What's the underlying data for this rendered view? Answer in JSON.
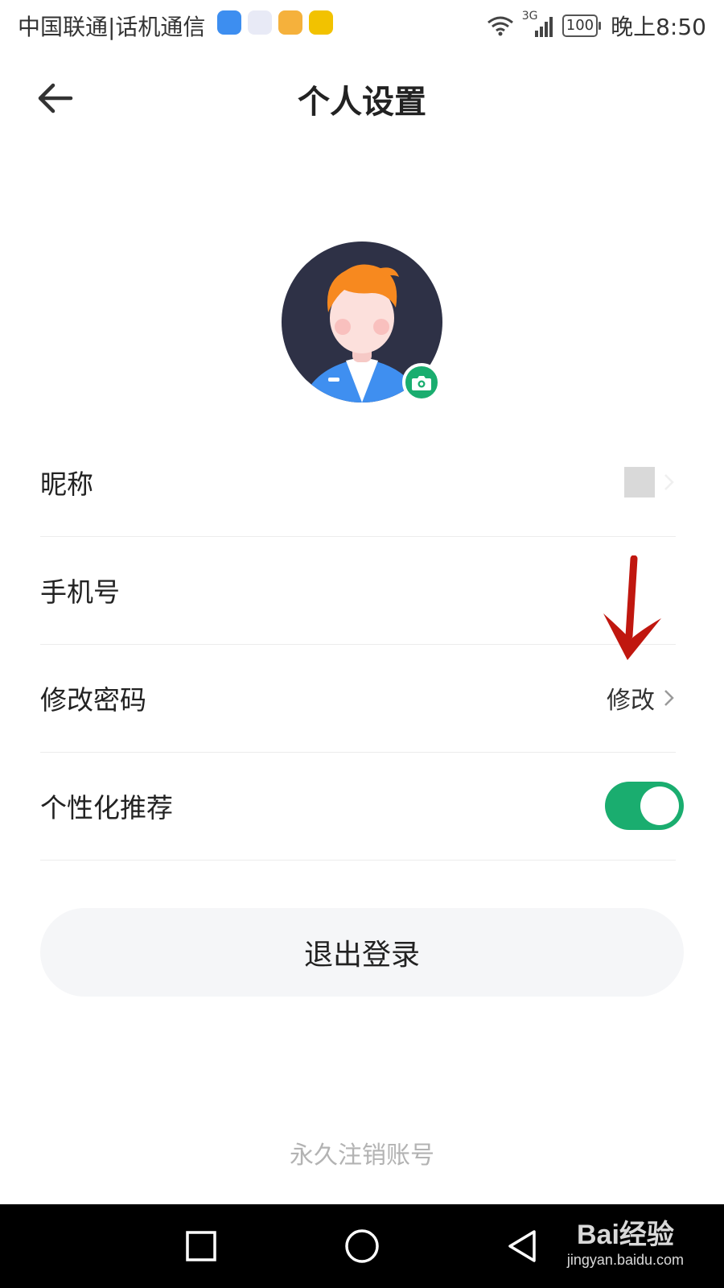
{
  "status_bar": {
    "carrier": "中国联通|话机通信",
    "network": "3G",
    "battery": "100",
    "time": "晚上8:50",
    "app_icons": [
      "bulb-app-icon",
      "robot-app-icon",
      "box-app-icon",
      "quiz-app-icon"
    ]
  },
  "header": {
    "title": "个人设置",
    "back_icon": "arrow-left-icon"
  },
  "avatar": {
    "camera_icon": "camera-icon",
    "badge_color": "#1aad6f"
  },
  "settings": {
    "nickname": {
      "label": "昵称"
    },
    "phone": {
      "label": "手机号"
    },
    "password": {
      "label": "修改密码",
      "action": "修改"
    },
    "personalized": {
      "label": "个性化推荐",
      "enabled": true
    }
  },
  "logout_label": "退出登录",
  "delete_account_label": "永久注销账号",
  "nav_bar": {
    "buttons": [
      "square-recents-icon",
      "circle-home-icon",
      "triangle-back-icon"
    ]
  },
  "watermark": {
    "logo": "Bai经验",
    "url": "jingyan.baidu.com"
  },
  "colors": {
    "accent": "#1aad6f",
    "annotation_arrow": "#c0170f"
  }
}
